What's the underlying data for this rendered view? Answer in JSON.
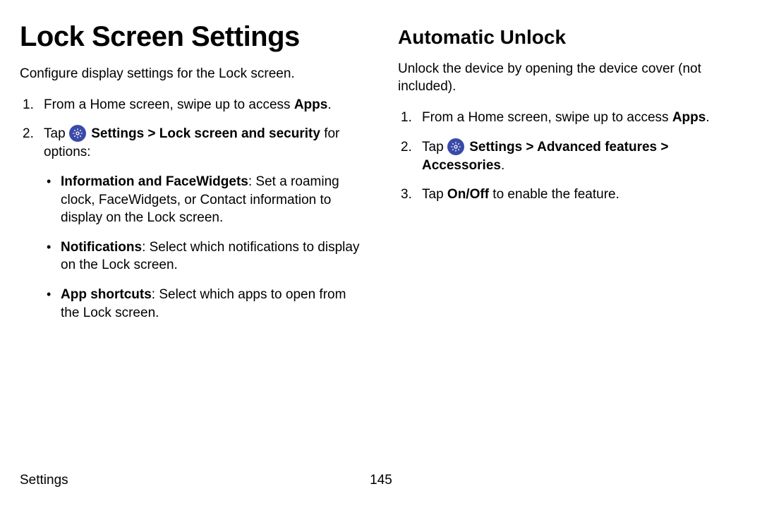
{
  "left": {
    "title": "Lock Screen Settings",
    "intro": "Configure display settings for the Lock screen.",
    "step1_pre": "From a Home screen, swipe up to access ",
    "step1_bold": "Apps",
    "step1_post": ".",
    "step2_pre": "Tap ",
    "step2_bold": "Settings > Lock screen and security",
    "step2_post": " for options:",
    "bullets": [
      {
        "bold": "Information and FaceWidgets",
        "text": ": Set a roaming clock, FaceWidgets, or Contact information to display on the Lock screen."
      },
      {
        "bold": "Notifications",
        "text": ": Select which notifications to display on the Lock screen."
      },
      {
        "bold": "App shortcuts",
        "text": ": Select which apps to open from the Lock screen."
      }
    ]
  },
  "right": {
    "title": "Automatic Unlock",
    "intro": "Unlock the device by opening the device cover (not included).",
    "step1_pre": "From a Home screen, swipe up to access ",
    "step1_bold": "Apps",
    "step1_post": ".",
    "step2_pre": "Tap ",
    "step2_bold": "Settings > Advanced features > Accessories",
    "step2_post": ".",
    "step3_pre": "Tap ",
    "step3_bold": "On/Off",
    "step3_post": " to enable the feature."
  },
  "footer": {
    "section": "Settings",
    "page": "145"
  }
}
